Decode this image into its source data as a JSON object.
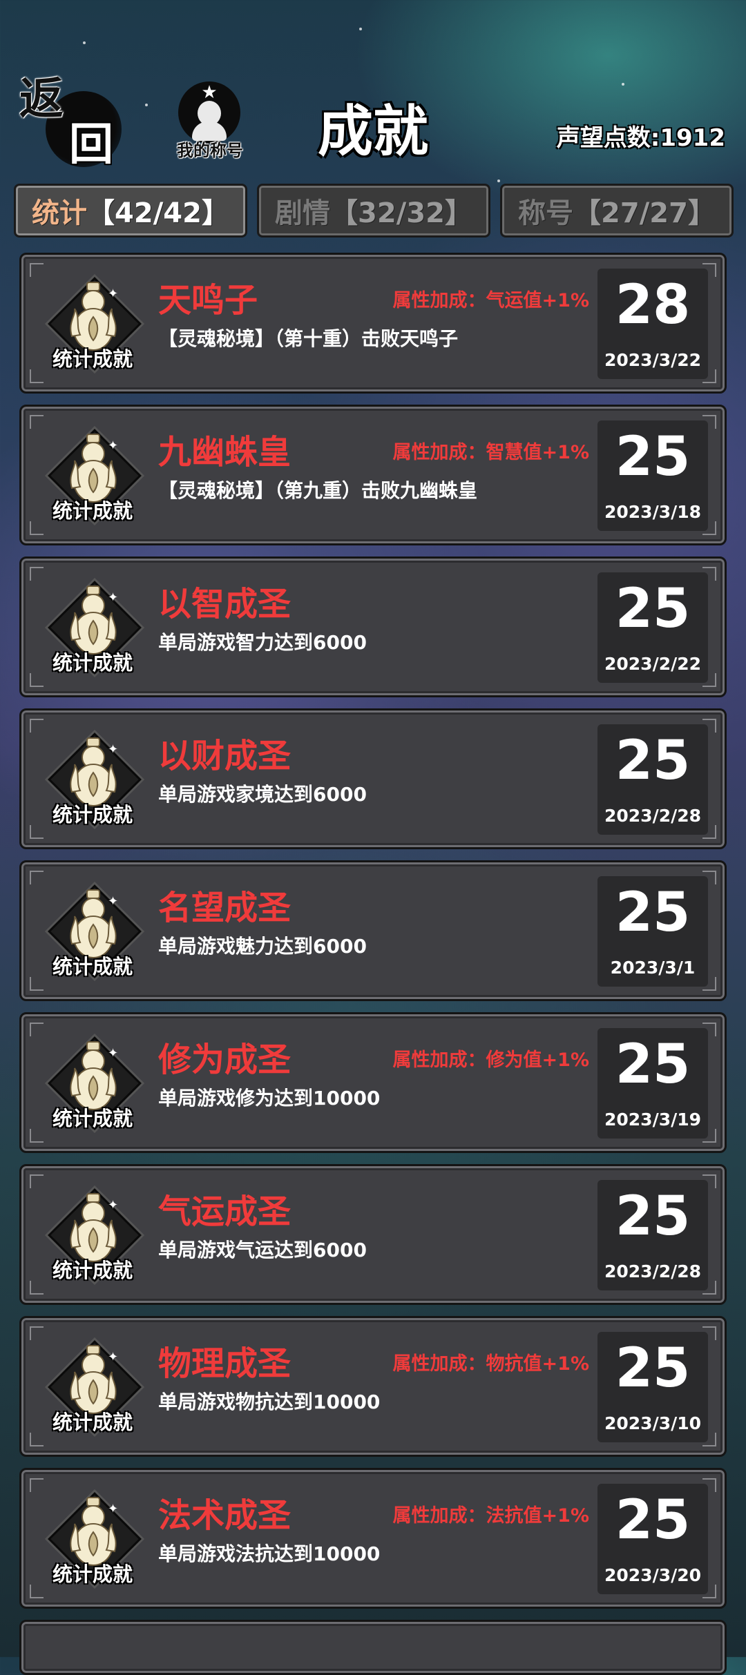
{
  "header": {
    "back_label_1": "返",
    "back_label_2": "回",
    "my_title_label": "我的称号",
    "page_title": "成就",
    "reputation": "声望点数:1912"
  },
  "tabs": [
    {
      "label": "统计",
      "count": "【42/42】",
      "active": true
    },
    {
      "label": "剧情",
      "count": "【32/32】",
      "active": false
    },
    {
      "label": "称号",
      "count": "【27/27】",
      "active": false
    }
  ],
  "badge_label": "统计成就",
  "achievements": [
    {
      "name": "天鸣子",
      "bonus": "属性加成：气运值+1%",
      "desc": "【灵魂秘境】（第十重）击败天鸣子",
      "score": "28",
      "date": "2023/3/22"
    },
    {
      "name": "九幽蛛皇",
      "bonus": "属性加成：智慧值+1%",
      "desc": "【灵魂秘境】（第九重）击败九幽蛛皇",
      "score": "25",
      "date": "2023/3/18"
    },
    {
      "name": "以智成圣",
      "bonus": "",
      "desc": "单局游戏智力达到6000",
      "score": "25",
      "date": "2023/2/22"
    },
    {
      "name": "以财成圣",
      "bonus": "",
      "desc": "单局游戏家境达到6000",
      "score": "25",
      "date": "2023/2/28"
    },
    {
      "name": "名望成圣",
      "bonus": "",
      "desc": "单局游戏魅力达到6000",
      "score": "25",
      "date": "2023/3/1"
    },
    {
      "name": "修为成圣",
      "bonus": "属性加成：修为值+1%",
      "desc": "单局游戏修为达到10000",
      "score": "25",
      "date": "2023/3/19"
    },
    {
      "name": "气运成圣",
      "bonus": "",
      "desc": "单局游戏气运达到6000",
      "score": "25",
      "date": "2023/2/28"
    },
    {
      "name": "物理成圣",
      "bonus": "属性加成：物抗值+1%",
      "desc": "单局游戏物抗达到10000",
      "score": "25",
      "date": "2023/3/10"
    },
    {
      "name": "法术成圣",
      "bonus": "属性加成：法抗值+1%",
      "desc": "单局游戏法抗达到10000",
      "score": "25",
      "date": "2023/3/20"
    }
  ]
}
